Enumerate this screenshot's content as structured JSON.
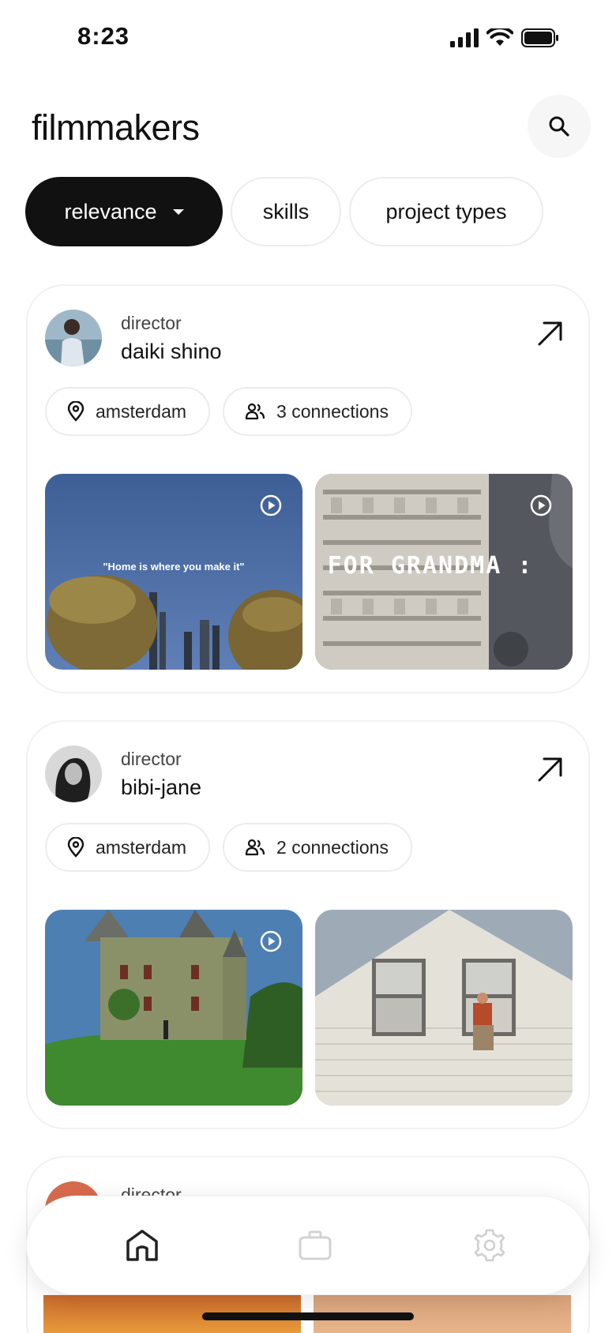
{
  "status_bar": {
    "time": "8:23"
  },
  "header": {
    "title": "filmmakers"
  },
  "filters": {
    "relevance_label": "relevance",
    "skills_label": "skills",
    "project_types_label": "project types"
  },
  "filmmakers": [
    {
      "role": "director",
      "name": "daiki shino",
      "location": "amsterdam",
      "connections": "3 connections",
      "thumb1_caption": "\"Home is where you make it\"",
      "thumb2_caption": "FOR GRANDMA :"
    },
    {
      "role": "director",
      "name": "bibi-jane",
      "location": "amsterdam",
      "connections": "2 connections"
    },
    {
      "role": "director"
    }
  ],
  "colors": {
    "primary": "#111111",
    "card_border": "#f1f1f1",
    "chip_border": "#ececec",
    "search_bg": "#f6f6f6"
  }
}
